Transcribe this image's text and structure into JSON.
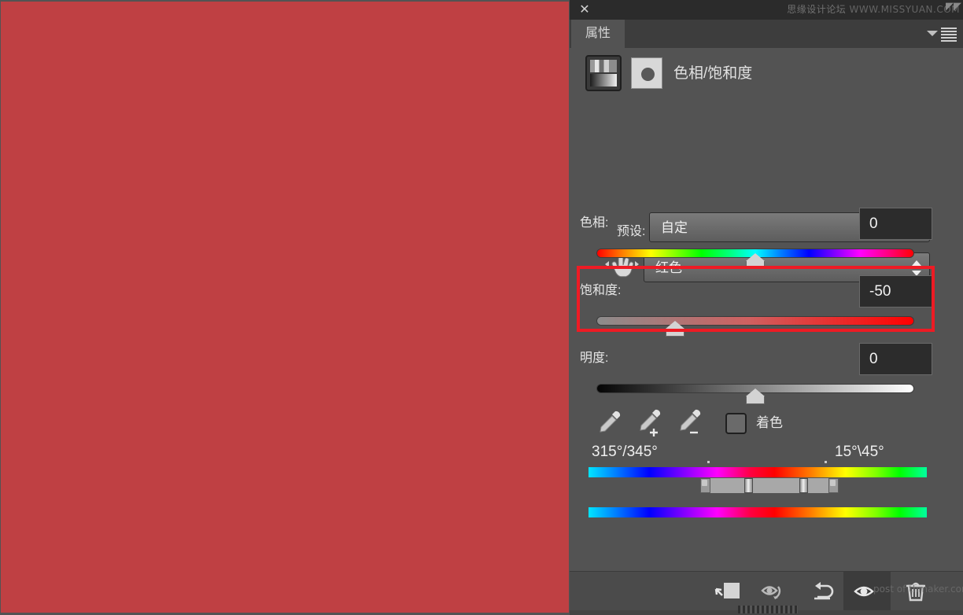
{
  "app": {
    "canvas": {
      "name": "document-canvas",
      "fill_color": "#bf4043"
    },
    "watermark_top_cn": "思缘设计论坛",
    "watermark_top_url": "WWW.MISSYUAN.COM",
    "watermark_bottom": "post of thmaker.com"
  },
  "panel": {
    "close_label": "✕",
    "tab_label": "属性",
    "adjustment_title": "色相/饱和度",
    "menu_icon": "panel-menu-icon",
    "collapse_icon": "chevron-down-icon"
  },
  "preset": {
    "label": "预设:",
    "value": "自定"
  },
  "channel": {
    "value": "红色",
    "tool_icon": "on-image-adjust-hand-icon"
  },
  "sliders": [
    {
      "name": "hue",
      "label": "色相:",
      "value": "0",
      "thumb_percent": 50,
      "highlighted": false
    },
    {
      "name": "saturation",
      "label": "饱和度:",
      "value": "-50",
      "thumb_percent": 26,
      "highlighted": true,
      "highlight_color": "#ee1b24"
    },
    {
      "name": "lightness",
      "label": "明度:",
      "value": "0",
      "thumb_percent": 50,
      "highlighted": false
    }
  ],
  "tools": {
    "eyedropper": "eyedropper-icon",
    "eyedropper_add": "eyedropper-add-icon",
    "eyedropper_subtract": "eyedropper-subtract-icon",
    "colorize_label": "着色",
    "colorize_checked": false
  },
  "color_range": {
    "left_label": "315°/345°",
    "right_label": "15°\\45°"
  },
  "footer": {
    "buttons": [
      {
        "name": "clip-to-layer-button",
        "icon": "clip-to-layer-icon"
      },
      {
        "name": "toggle-preview-button",
        "icon": "eye-toggle-icon"
      },
      {
        "name": "reset-button",
        "icon": "reset-arrow-icon"
      },
      {
        "name": "visibility-button",
        "icon": "eye-icon",
        "active": true
      },
      {
        "name": "delete-button",
        "icon": "trash-icon"
      }
    ]
  }
}
